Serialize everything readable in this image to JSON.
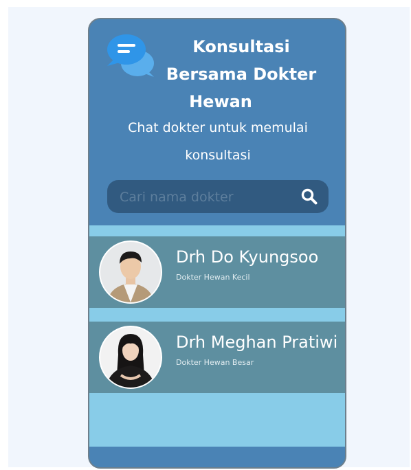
{
  "header": {
    "title_lines": [
      "Konsultasi",
      "Bersama Dokter",
      "Hewan"
    ],
    "subtitle_lines": [
      "Chat dokter untuk memulai",
      "konsultasi"
    ],
    "logo_icon": "chat-bubbles-icon"
  },
  "search": {
    "placeholder": "Cari nama dokter",
    "value": "",
    "icon": "search-icon"
  },
  "doctors": [
    {
      "name": "Drh Do Kyungsoo",
      "specialty": "Dokter Hewan Kecil",
      "avatar": "male-doctor-photo"
    },
    {
      "name": "Drh Meghan Pratiwi",
      "specialty": "Dokter Hewan Besar",
      "avatar": "female-doctor-photo"
    }
  ],
  "colors": {
    "primary": "#4a83b5",
    "search_bg": "#315a80",
    "list_bg": "#88cce8",
    "card_bg": "#5e8fa0",
    "logo_front": "#2f95e8",
    "logo_back": "#5aaeec"
  }
}
